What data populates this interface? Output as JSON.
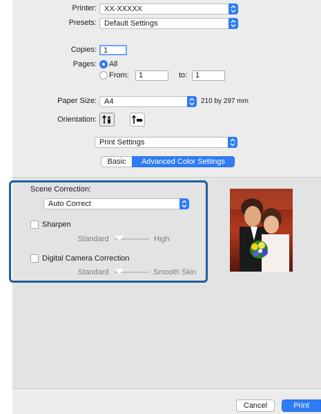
{
  "printer": {
    "label": "Printer:",
    "value": "XX-XXXXX"
  },
  "presets": {
    "label": "Presets:",
    "value": "Default Settings"
  },
  "copies": {
    "label": "Copies:",
    "value": "1"
  },
  "pages": {
    "label": "Pages:",
    "all_label": "All",
    "from_label": "From:",
    "from_value": "1",
    "to_label": "to:",
    "to_value": "1"
  },
  "paper_size": {
    "label": "Paper Size:",
    "value": "A4",
    "dimensions": "210 by 297 mm"
  },
  "orientation": {
    "label": "Orientation:",
    "options": [
      "portrait-icon",
      "landscape-icon"
    ],
    "selected": "portrait"
  },
  "panel_select": {
    "value": "Print Settings"
  },
  "tabs": {
    "basic": "Basic",
    "advanced": "Advanced Color Settings",
    "active": "Advanced Color Settings"
  },
  "scene_correction": {
    "label": "Scene Correction:",
    "value": "Auto Correct"
  },
  "sharpen": {
    "label": "Sharpen",
    "checked": false,
    "slider_min": "Standard",
    "slider_max": "High"
  },
  "digital_camera_correction": {
    "label": "Digital Camera Correction",
    "checked": false,
    "slider_min": "Standard",
    "slider_max": "Smooth Skin"
  },
  "buttons": {
    "cancel": "Cancel",
    "print": "Print"
  },
  "colors": {
    "accent": "#2e7cf6",
    "highlight_border": "#1f5c9e"
  }
}
